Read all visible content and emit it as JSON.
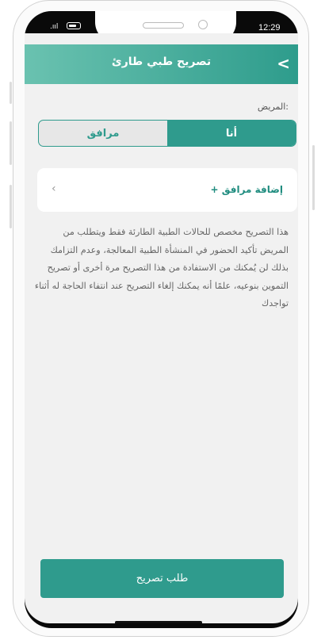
{
  "status_bar": {
    "signal": ".ııl",
    "time": "12:29"
  },
  "header": {
    "title": "تصريح طبي طارئ",
    "back_glyph": "<"
  },
  "patient_label": "المريض:",
  "segment": {
    "selected": "أنا",
    "other": "مرافق"
  },
  "add_companion": {
    "label": "+ إضافة مرافق",
    "chevron": "‹"
  },
  "info_text": "هذا التصريح مخصص للحالات الطبية الطارئة فقط ويتطلب من المريض تأكيد الحضور في المنشأة الطبية المعالجة، وعدم التزامك بذلك لن يُمكنك من الاستفادة من هذا التصريح مرة أخرى أو تصريح التموين بنوعيه، علمًا أنه يمكنك إلغاء التصريح عند انتفاء الحاجة له أثناء تواجدك",
  "submit_label": "طلب تصريح",
  "colors": {
    "primary": "#2f9b8d",
    "header_start": "#6ac2b0",
    "background": "#f1f1f1"
  }
}
